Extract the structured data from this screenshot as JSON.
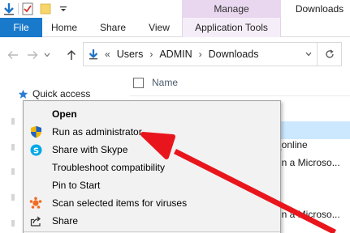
{
  "window": {
    "manage_label": "Manage",
    "title": "Downloads"
  },
  "ribbon": {
    "file_label": "File",
    "home_label": "Home",
    "share_label": "Share",
    "view_label": "View",
    "app_tools_label": "Application Tools"
  },
  "address": {
    "overflow": "«",
    "parts": [
      "Users",
      "ADMIN",
      "Downloads"
    ],
    "separator": "›"
  },
  "nav_pane": {
    "quick_access": "Quick access"
  },
  "file_list": {
    "column_name": "Name",
    "fragments": [
      "_online",
      "in a Microso...",
      "in a Microso..."
    ]
  },
  "context_menu": {
    "items": [
      {
        "label": "Open",
        "icon": "none",
        "bold": true
      },
      {
        "label": "Run as administrator",
        "icon": "uac-shield-icon"
      },
      {
        "label": "Share with Skype",
        "icon": "skype-icon"
      },
      {
        "label": "Troubleshoot compatibility",
        "icon": "none"
      },
      {
        "label": "Pin to Start",
        "icon": "none"
      },
      {
        "label": "Scan selected items for viruses",
        "icon": "avast-icon"
      },
      {
        "label": "Share",
        "icon": "share-icon"
      }
    ]
  },
  "colors": {
    "file_tab": "#1979ca",
    "manage_tab": "#e8d7ef",
    "selection": "#cce8ff",
    "arrow": "#e8161c"
  }
}
